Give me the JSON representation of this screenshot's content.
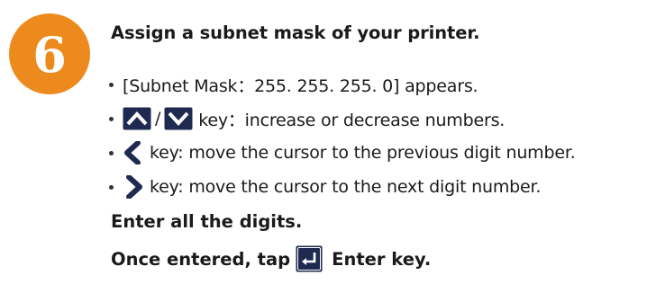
{
  "step": {
    "number": "6",
    "heading": "Assign a subnet mask of your printer."
  },
  "bullets": {
    "subnet_text": "[Subnet Mask：255. 255. 255. 0] appears.",
    "updown_separator": "/",
    "updown_text": "key：increase or decrease numbers.",
    "left_text": "key: move the cursor to the previous digit number.",
    "right_text": "key: move the cursor to the next digit number."
  },
  "footer": {
    "enter_digits": "Enter all the digits.",
    "once_entered": "Once entered, tap",
    "enter_key_label": "Enter key."
  },
  "colors": {
    "badge": "#ec8a1e",
    "key_icon": "#1f2a50",
    "text": "#1a1a1a"
  },
  "icons": [
    "up-arrow-key-icon",
    "down-arrow-key-icon",
    "left-arrow-key-icon",
    "right-arrow-key-icon",
    "enter-key-icon"
  ]
}
